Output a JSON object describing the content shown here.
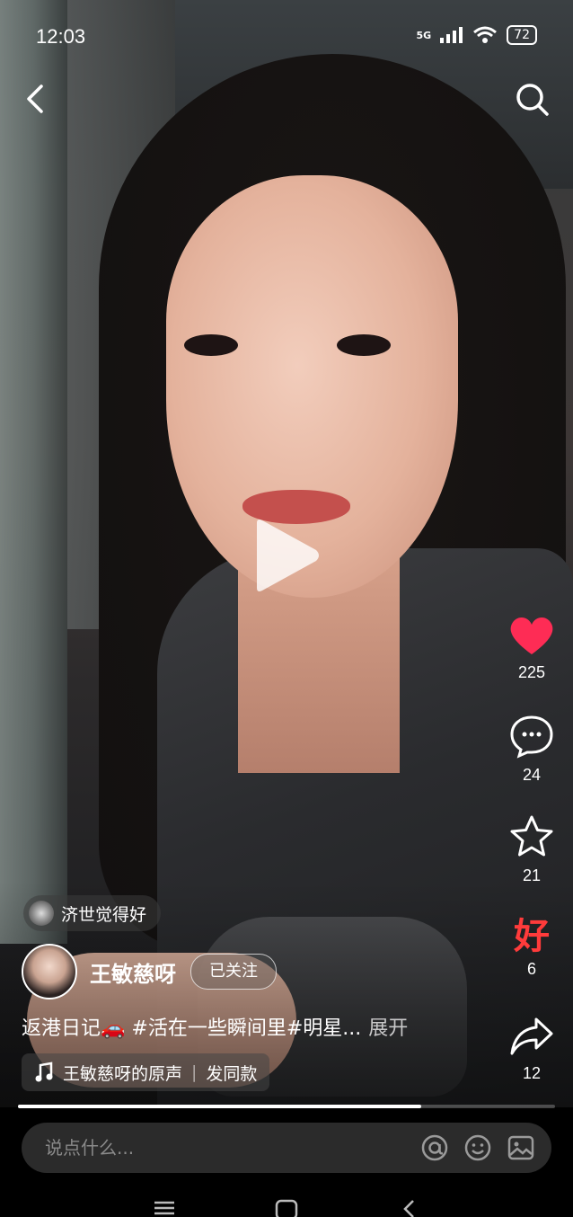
{
  "status_bar": {
    "time": "12:03",
    "signal": "5G",
    "battery": "72"
  },
  "video": {
    "playing": false,
    "progress": 0.75
  },
  "actions": {
    "like_count": "225",
    "comment_count": "24",
    "favorite_count": "21",
    "good_label": "好",
    "good_count": "6",
    "share_count": "12"
  },
  "friend_like": {
    "text": "济世觉得好"
  },
  "author": {
    "name": "王敏慈呀",
    "follow_label": "已关注"
  },
  "caption": {
    "text": "返港日记🚗 #活在一些瞬间里#明星...",
    "expand_label": "展开"
  },
  "music": {
    "title": "王敏慈呀的原声",
    "use_sound_label": "发同款"
  },
  "comment_bar": {
    "placeholder": "说点什么..."
  },
  "colors": {
    "like": "#fe2c55",
    "good": "#ff3b3b",
    "input_bg": "#2b2b2b"
  },
  "icons": [
    "back-icon",
    "search-icon",
    "play-icon",
    "heart-icon",
    "comment-icon",
    "star-icon",
    "share-icon",
    "music-note-icon",
    "at-icon",
    "emoji-icon",
    "image-icon",
    "menu-icon",
    "home-icon",
    "nav-back-icon"
  ]
}
